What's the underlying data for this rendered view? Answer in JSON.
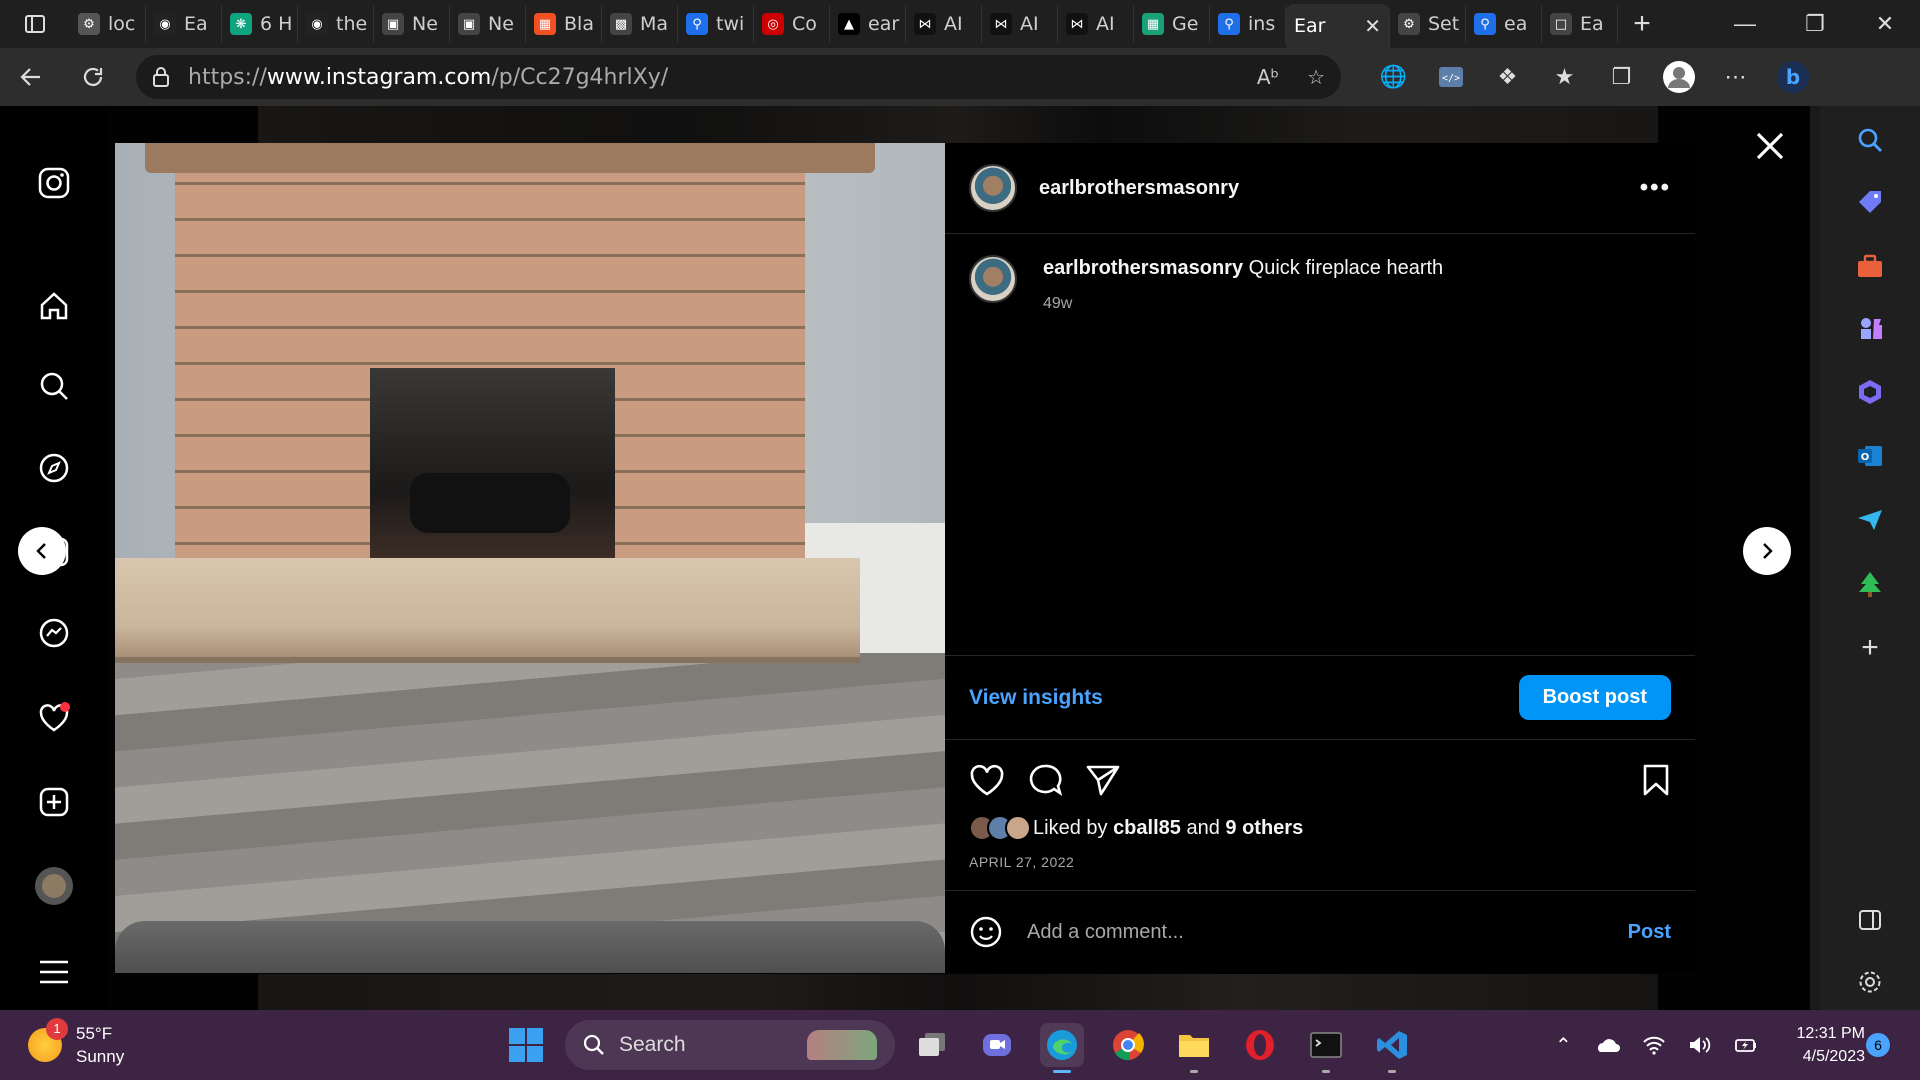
{
  "browser": {
    "tabs": [
      {
        "label": "loc",
        "icon": "page-gear-icon",
        "color": "#555555"
      },
      {
        "label": "Ea",
        "icon": "github-icon",
        "color": "#222222"
      },
      {
        "label": "6 H",
        "icon": "openai-icon",
        "color": "#10a37f"
      },
      {
        "label": "the",
        "icon": "github-icon",
        "color": "#222222"
      },
      {
        "label": "Ne",
        "icon": "window-icon",
        "color": "#444444"
      },
      {
        "label": "Ne",
        "icon": "window-icon",
        "color": "#444444"
      },
      {
        "label": "Bla",
        "icon": "microsoft-icon",
        "color": "#f25022"
      },
      {
        "label": "Ma",
        "icon": "qr-icon",
        "color": "#444444"
      },
      {
        "label": "twi",
        "icon": "search-icon",
        "color": "#1f6feb"
      },
      {
        "label": "Co",
        "icon": "target-icon",
        "color": "#cc0000"
      },
      {
        "label": "ear",
        "icon": "triangle-icon",
        "color": "#000000"
      },
      {
        "label": "AI",
        "icon": "bowtie-icon",
        "color": "#111111"
      },
      {
        "label": "AI",
        "icon": "bowtie-icon",
        "color": "#111111"
      },
      {
        "label": "AI",
        "icon": "bowtie-icon",
        "color": "#111111"
      },
      {
        "label": "Ge",
        "icon": "grid-icon",
        "color": "#1aa179"
      },
      {
        "label": "ins",
        "icon": "search-icon",
        "color": "#1f6feb"
      },
      {
        "label": "Ear",
        "icon": "",
        "color": "#2d2d2d",
        "active": true
      },
      {
        "label": "Set",
        "icon": "gear-icon",
        "color": "#444444"
      },
      {
        "label": "ea",
        "icon": "search-icon",
        "color": "#1f6feb"
      },
      {
        "label": "Ea",
        "icon": "page-icon",
        "color": "#444444"
      }
    ],
    "url_prefix": "https://",
    "url_host": "www.instagram.com",
    "url_path": "/p/Cc27g4hrlXy/"
  },
  "post": {
    "username": "earlbrothersmasonry",
    "caption_user": "earlbrothersmasonry",
    "caption_text": "Quick fireplace hearth",
    "age": "49w",
    "view_insights": "View insights",
    "boost_post": "Boost post",
    "liked_prefix": "Liked by",
    "liked_user": "cball85",
    "liked_and": "and",
    "liked_others": "9 others",
    "date": "APRIL 27, 2022",
    "comment_placeholder": "Add a comment...",
    "comment_post": "Post"
  },
  "taskbar": {
    "weather_temp": "55°F",
    "weather_cond": "Sunny",
    "weather_badge": "1",
    "search_label": "Search",
    "time": "12:31 PM",
    "date": "4/5/2023",
    "notifications": "6"
  },
  "colors": {
    "accent_blue": "#0095f6",
    "link_blue": "#4aa3ff",
    "taskbar": "#3d2444"
  }
}
